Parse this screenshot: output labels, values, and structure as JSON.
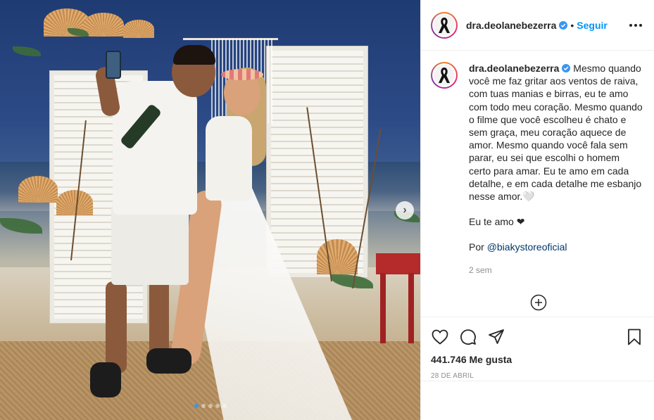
{
  "post": {
    "username": "dra.deolanebezerra",
    "separator": "•",
    "follow_label": "Seguir",
    "caption_lines": [
      "Mesmo quando você me faz gritar aos ventos de raiva, com tuas manias e birras, eu te amo com todo meu coração. Mesmo quando o filme que você escolheu é chato e sem graça, meu coração aquece de amor. Mesmo quando você fala sem parar, eu sei que escolhi o homem certo para amar. Eu te amo em cada detalhe, e em cada detalhe me esbanjo nesse amor.🤍"
    ],
    "caption_love": "Eu te amo ❤",
    "caption_by_prefix": "Por ",
    "caption_mention": "@biakystoreoficial",
    "time_ago": "2 sem",
    "likes_count": "441.746",
    "likes_label": "Me gusta",
    "date": "28 de abril"
  },
  "carousel": {
    "next_glyph": "›",
    "slide_count": 5,
    "active_index": 0
  },
  "colors": {
    "link_blue": "#0095f6",
    "mention_blue": "#00376b",
    "muted_gray": "#8e8e8e"
  },
  "icons": [
    "verified-badge-icon",
    "more-options-icon",
    "load-more-comments-icon",
    "like-heart-icon",
    "comment-icon",
    "share-icon",
    "save-bookmark-icon",
    "black-ribbon-icon",
    "carousel-next-icon"
  ]
}
